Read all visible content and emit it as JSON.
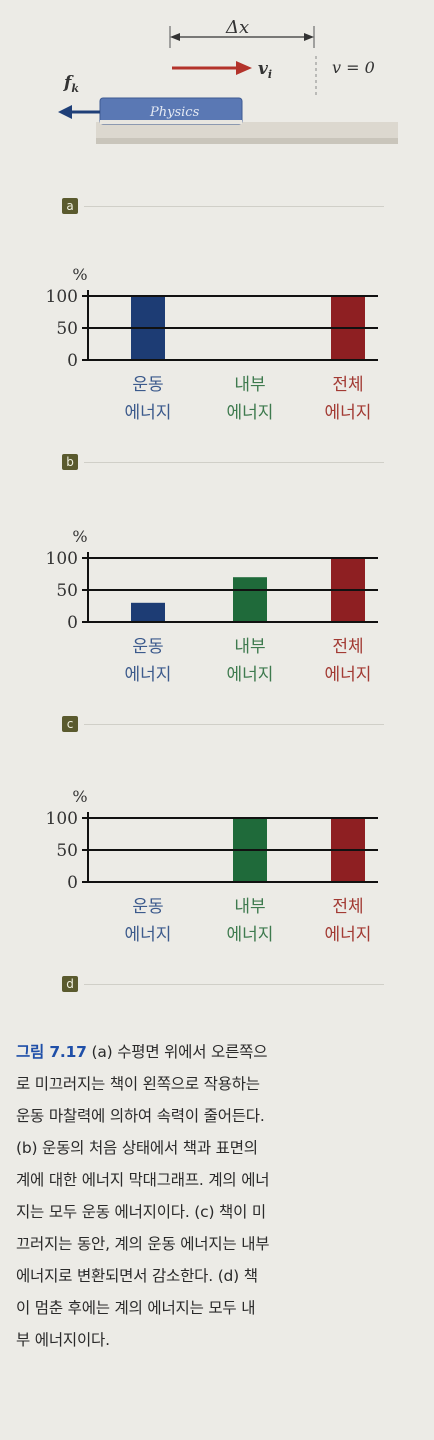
{
  "panel_a": {
    "dx_label": "Δx",
    "v_label": "v",
    "v_sub": "i",
    "v_final": "v = 0",
    "f_label": "f",
    "f_sub": "k",
    "book_label": "Physics",
    "tag": "a"
  },
  "colors": {
    "kinetic": "#1d3c74",
    "internal": "#1f6a3a",
    "total": "#8e1f22",
    "kinetic_text": "#3c5a8c",
    "internal_text": "#3e7a4e",
    "total_text": "#a23a33",
    "arrow_red": "#b3332b",
    "arrow_blue": "#1f3f78"
  },
  "chart_data": [
    {
      "type": "bar",
      "tag": "b",
      "ylabel": "%",
      "yticks": [
        "100",
        "50",
        "0"
      ],
      "ylim": [
        0,
        100
      ],
      "categories": [
        "운동 에너지",
        "내부 에너지",
        "전체 에너지"
      ],
      "cat_lines": [
        [
          "운동",
          "에너지"
        ],
        [
          "내부",
          "에너지"
        ],
        [
          "전체",
          "에너지"
        ]
      ],
      "values": [
        100,
        0,
        100
      ]
    },
    {
      "type": "bar",
      "tag": "c",
      "ylabel": "%",
      "yticks": [
        "100",
        "50",
        "0"
      ],
      "ylim": [
        0,
        100
      ],
      "categories": [
        "운동 에너지",
        "내부 에너지",
        "전체 에너지"
      ],
      "cat_lines": [
        [
          "운동",
          "에너지"
        ],
        [
          "내부",
          "에너지"
        ],
        [
          "전체",
          "에너지"
        ]
      ],
      "values": [
        30,
        70,
        100
      ]
    },
    {
      "type": "bar",
      "tag": "d",
      "ylabel": "%",
      "yticks": [
        "100",
        "50",
        "0"
      ],
      "ylim": [
        0,
        100
      ],
      "categories": [
        "운동 에너지",
        "내부 에너지",
        "전체 에너지"
      ],
      "cat_lines": [
        [
          "운동",
          "에너지"
        ],
        [
          "내부",
          "에너지"
        ],
        [
          "전체",
          "에너지"
        ]
      ],
      "values": [
        0,
        100,
        100
      ]
    }
  ],
  "caption": {
    "label": "그림 7.17",
    "lines": [
      "(a) 수평면 위에서 오른쪽으",
      "로 미끄러지는 책이 왼쪽으로 작용하는",
      "운동 마찰력에 의하여 속력이 줄어든다.",
      "(b) 운동의 처음 상태에서 책과 표면의",
      "계에 대한 에너지 막대그래프. 계의 에너",
      "지는 모두 운동 에너지이다. (c) 책이 미",
      "끄러지는 동안, 계의 운동 에너지는 내부",
      "에너지로 변환되면서 감소한다. (d) 책",
      "이 멈춘 후에는 계의 에너지는 모두 내",
      "부 에너지이다."
    ]
  }
}
